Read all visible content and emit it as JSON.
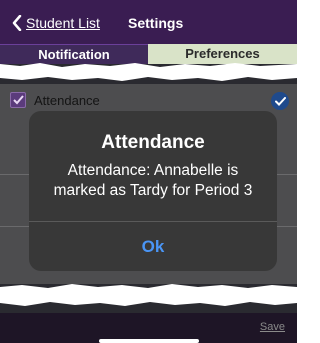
{
  "navbar": {
    "back_label": "Student List",
    "title": "Settings"
  },
  "tabs": [
    {
      "label": "Notification",
      "active": true
    },
    {
      "label": "Preferences",
      "active": false
    }
  ],
  "list": {
    "items": [
      {
        "label": "Attendance",
        "checked": true
      }
    ]
  },
  "alert": {
    "title": "Attendance",
    "message": "Attendance: Annabelle is marked as Tardy for Period 3",
    "button": "Ok"
  },
  "footer": {
    "save_label": "Save"
  },
  "colors": {
    "navbar": "#3a1d52",
    "tab_preferences": "#d9e3c8",
    "alert_bg": "#383838",
    "ok_blue": "#4a95f5"
  }
}
